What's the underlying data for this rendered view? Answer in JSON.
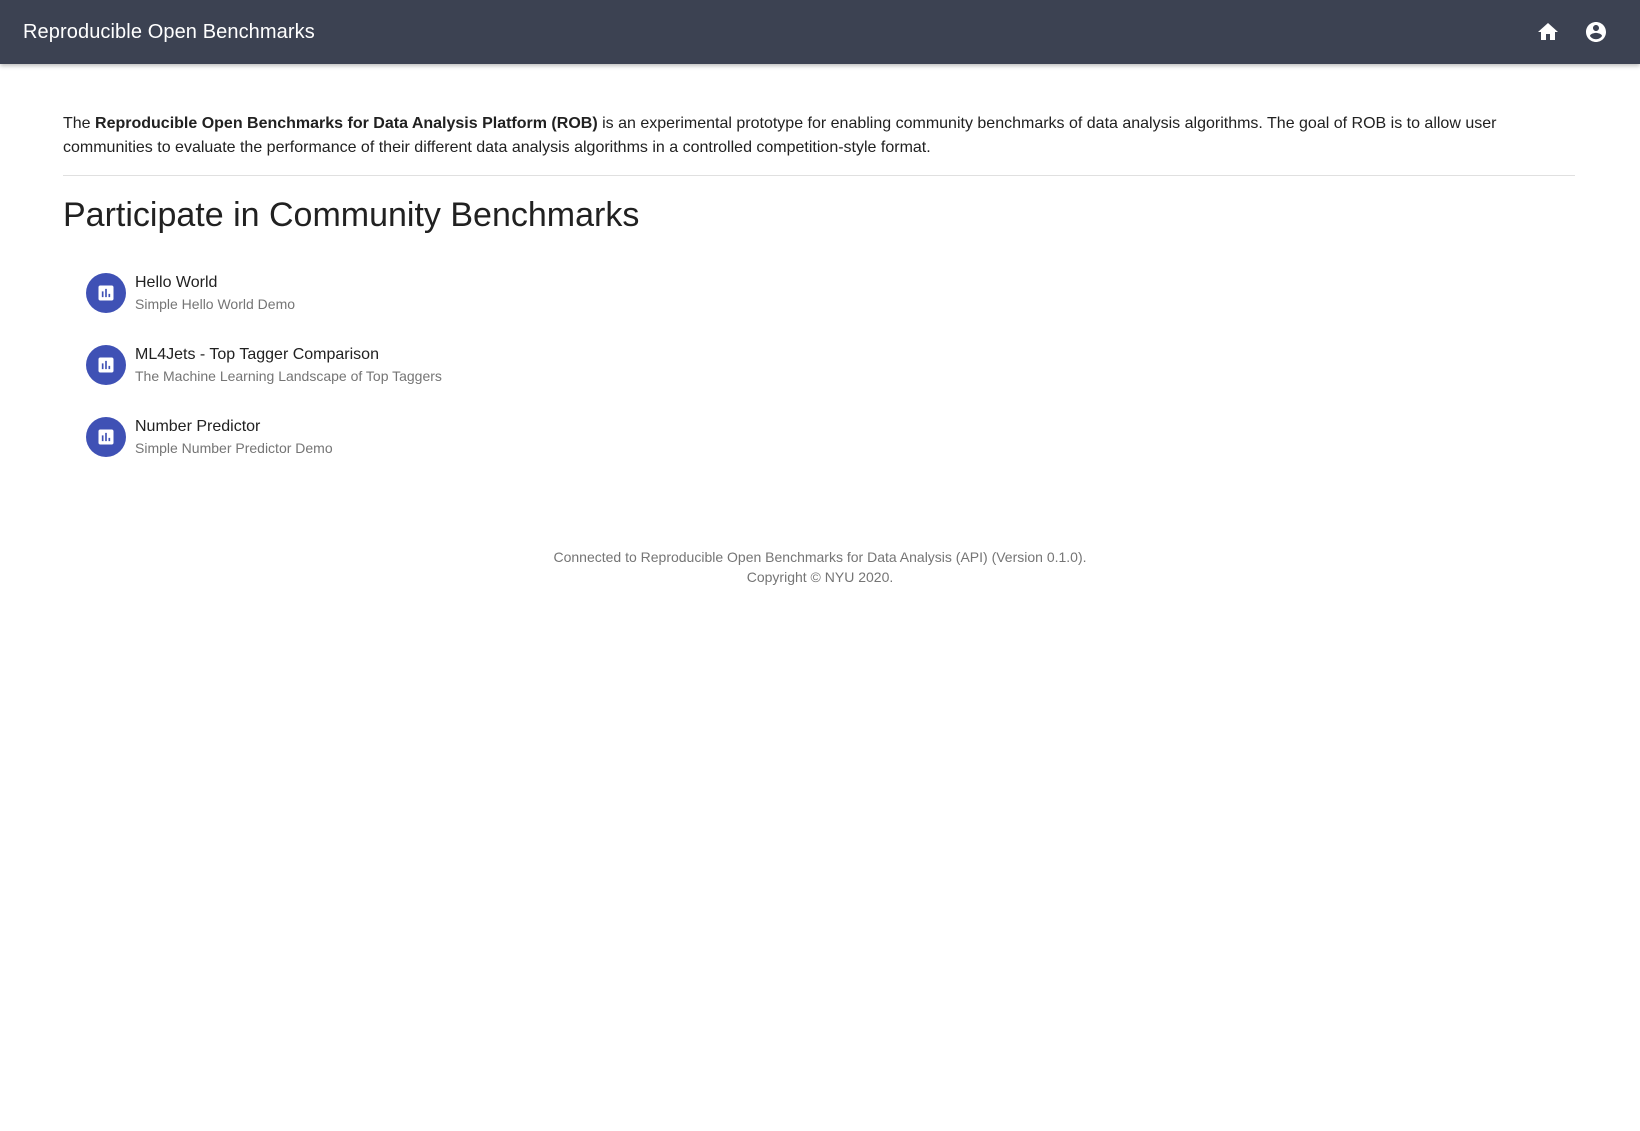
{
  "app": {
    "title": "Reproducible Open Benchmarks",
    "actions": [
      {
        "name": "home-icon"
      },
      {
        "name": "account-circle-icon"
      }
    ]
  },
  "intro": {
    "prefix": "The ",
    "platform_name": "Reproducible Open Benchmarks for Data Analysis Platform (ROB)",
    "suffix": " is an experimental prototype for enabling community benchmarks of data analysis algorithms. The goal of ROB is to allow user communities to evaluate the performance of their different data analysis algorithms in a controlled competition-style format."
  },
  "section": {
    "title": "Participate in Community Benchmarks"
  },
  "benchmarks": [
    {
      "title": "Hello World",
      "description": "Simple Hello World Demo",
      "icon": "bar-chart-icon"
    },
    {
      "title": "ML4Jets - Top Tagger Comparison",
      "description": "The Machine Learning Landscape of Top Taggers",
      "icon": "bar-chart-icon"
    },
    {
      "title": "Number Predictor",
      "description": "Simple Number Predictor Demo",
      "icon": "bar-chart-icon"
    }
  ],
  "footer": {
    "connected": "Connected to Reproducible Open Benchmarks for Data Analysis (API) (Version 0.1.0).",
    "copyright": "Copyright © NYU 2020."
  },
  "colors": {
    "appbar": "#3c4252",
    "avatar": "#3f51b5",
    "secondary_text": "#757575"
  }
}
